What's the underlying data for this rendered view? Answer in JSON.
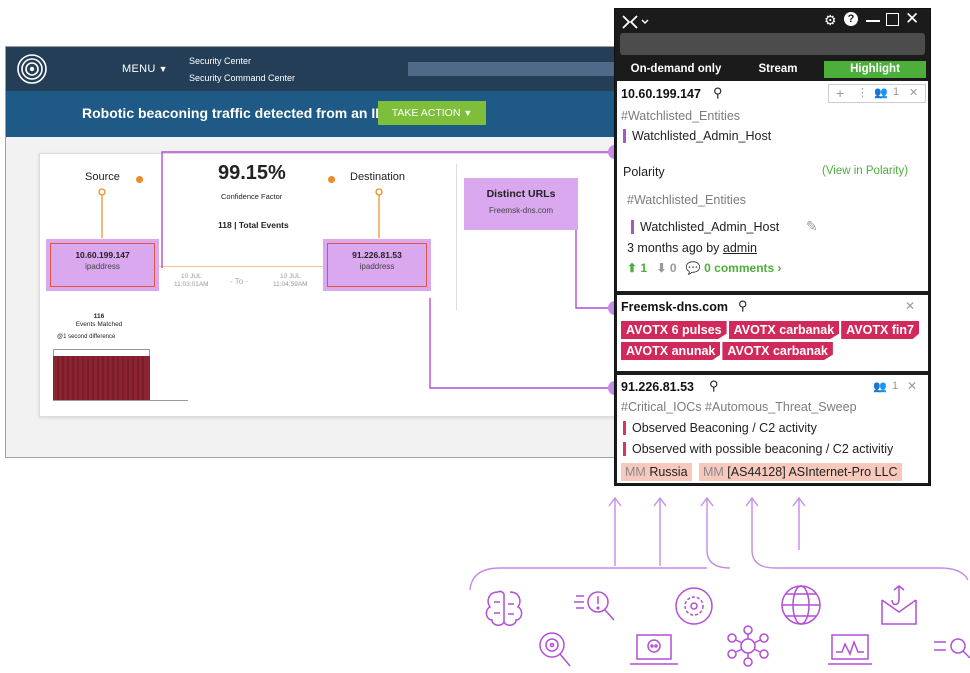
{
  "security_center": {
    "menu_label": "MENU",
    "title_line1": "Security Center",
    "title_line2": "Security Command Center",
    "alert_text": "Robotic beaconing traffic detected from an IP",
    "action_label": "TAKE ACTION",
    "source_label": "Source",
    "destination_label": "Destination",
    "confidence_value": "99.15%",
    "confidence_label": "Confidence Factor",
    "total_events": "118 | Total Events",
    "source_ip": "10.60.199.147",
    "source_type": "ipaddress",
    "dest_ip": "91.226.81.53",
    "dest_type": "ipaddress",
    "time_from_date": "10 JUL",
    "time_from_time": "11:03:01AM",
    "time_to_label": "- To -",
    "time_to_date": "10 JUL",
    "time_to_time": "11:04:59AM",
    "events_matched_count": "116",
    "events_matched_label": "Events Matched",
    "events_matched_note": "@1 second difference",
    "distinct_urls_title": "Distinct URLs",
    "distinct_urls_value": "Freemsk-dns.com"
  },
  "polarity": {
    "tabs": [
      "On-demand only",
      "Stream",
      "Highlight"
    ],
    "active_tab_color": "#4caf3a",
    "panel1": {
      "title": "10.60.199.147",
      "user_count": "1",
      "tag": "#Watchlisted_Entities",
      "item": "Watchlisted_Admin_Host",
      "section_label": "Polarity",
      "view_link": "(View in Polarity)",
      "tag2": "#Watchlisted_Entities",
      "item2": "Watchlisted_Admin_Host",
      "meta_prefix": "3 months ago by ",
      "meta_user": "admin",
      "upvotes": "1",
      "downvotes": "0",
      "comments": "0 comments"
    },
    "panel2": {
      "title": "Freemsk-dns.com",
      "tags": [
        "AVOTX 6 pulses",
        "AVOTX carbanak",
        "AVOTX fin7",
        "AVOTX anunak",
        "AVOTX carbanak"
      ]
    },
    "panel3": {
      "title": "91.226.81.53",
      "user_count": "1",
      "tags": "#Critical_IOCs #Automous_Threat_Sweep",
      "items": [
        "Observed Beaconing / C2 activity",
        "Observed with possible beaconing / C2 activitiy"
      ],
      "mm_tags": [
        {
          "prefix": "MM",
          "value": "Russia"
        },
        {
          "prefix": "MM",
          "value": "[AS44128] ASInternet-Pro LLC"
        }
      ]
    }
  },
  "colors": {
    "accent_purple": "#b24fd6",
    "navy": "#243e58",
    "green": "#7dbf3b",
    "pink_tag": "#d12a5a"
  },
  "icons": [
    "brain-icon",
    "alert-search-icon",
    "gear-cycle-icon",
    "globe-icon",
    "phishing-mail-icon",
    "target-search-icon",
    "skull-laptop-icon",
    "network-icon",
    "monitor-chart-icon",
    "search-icon"
  ]
}
